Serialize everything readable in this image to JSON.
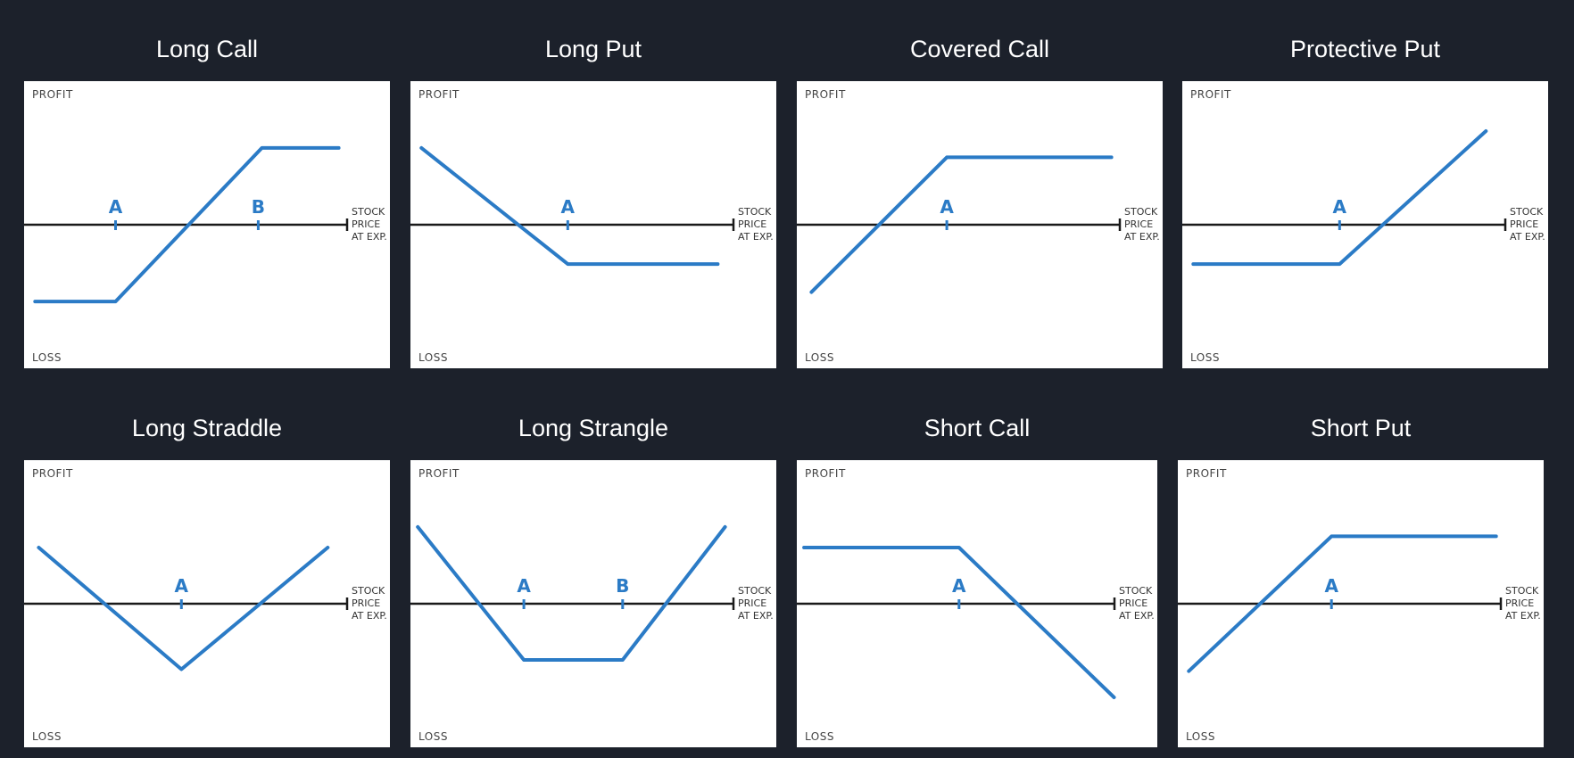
{
  "colors": {
    "background": "#1c212b",
    "payoff_line": "#2b7bc6",
    "axis": "#1a1a1a"
  },
  "labels": {
    "profit": "PROFIT",
    "loss": "LOSS",
    "x_axis": [
      "STOCK",
      "PRICE",
      "AT EXP."
    ]
  },
  "panels": [
    {
      "title": "Long Call",
      "strikes": [
        {
          "label": "A",
          "x": 0.25
        },
        {
          "label": "B",
          "x": 0.64
        }
      ],
      "payoff": [
        [
          0.03,
          -0.82
        ],
        [
          0.25,
          -0.82
        ],
        [
          0.65,
          0.82
        ],
        [
          0.86,
          0.82
        ]
      ]
    },
    {
      "title": "Long Put",
      "strikes": [
        {
          "label": "A",
          "x": 0.43
        }
      ],
      "payoff": [
        [
          0.03,
          0.82
        ],
        [
          0.43,
          -0.42
        ],
        [
          0.84,
          -0.42
        ]
      ]
    },
    {
      "title": "Covered Call",
      "strikes": [
        {
          "label": "A",
          "x": 0.41
        }
      ],
      "payoff": [
        [
          0.04,
          -0.72
        ],
        [
          0.41,
          0.72
        ],
        [
          0.86,
          0.72
        ]
      ]
    },
    {
      "title": "Protective Put",
      "strikes": [
        {
          "label": "A",
          "x": 0.43
        }
      ],
      "payoff": [
        [
          0.03,
          -0.42
        ],
        [
          0.43,
          -0.42
        ],
        [
          0.83,
          1.0
        ]
      ]
    },
    {
      "title": "Long Straddle",
      "strikes": [
        {
          "label": "A",
          "x": 0.43
        }
      ],
      "payoff": [
        [
          0.04,
          0.6
        ],
        [
          0.43,
          -0.7
        ],
        [
          0.83,
          0.6
        ]
      ]
    },
    {
      "title": "Long Strangle",
      "strikes": [
        {
          "label": "A",
          "x": 0.31
        },
        {
          "label": "B",
          "x": 0.58
        }
      ],
      "payoff": [
        [
          0.02,
          0.82
        ],
        [
          0.31,
          -0.6
        ],
        [
          0.58,
          -0.6
        ],
        [
          0.86,
          0.82
        ]
      ]
    },
    {
      "title": "Short Call",
      "strikes": [
        {
          "label": "A",
          "x": 0.45
        }
      ],
      "payoff": [
        [
          0.02,
          0.6
        ],
        [
          0.45,
          0.6
        ],
        [
          0.88,
          -1.0
        ]
      ]
    },
    {
      "title": "Short Put",
      "strikes": [
        {
          "label": "A",
          "x": 0.42
        }
      ],
      "payoff": [
        [
          0.03,
          -0.72
        ],
        [
          0.42,
          0.72
        ],
        [
          0.87,
          0.72
        ]
      ]
    }
  ]
}
